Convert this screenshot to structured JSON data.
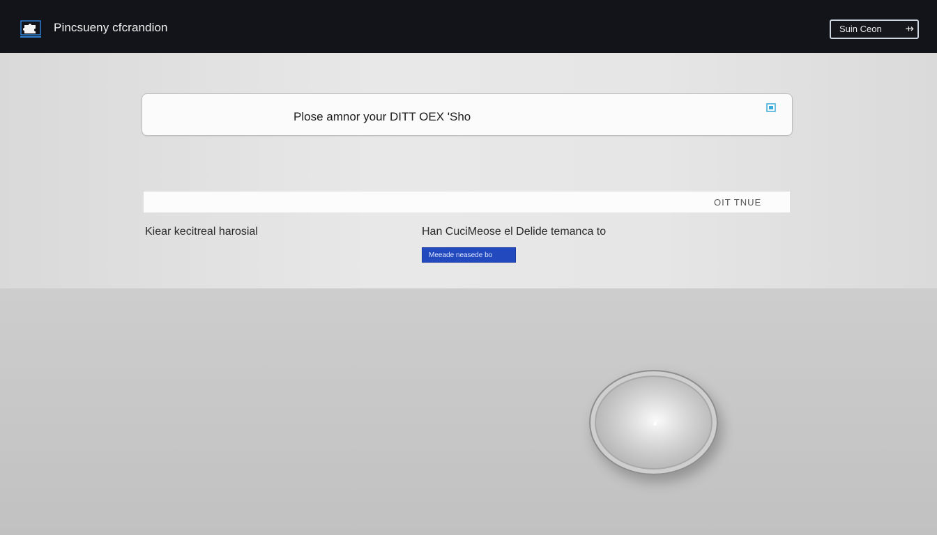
{
  "header": {
    "title": "Pincsueny cfcrandion",
    "logo_icon": "puzzle-icon",
    "button_label": "Suin Ceon",
    "button_icon": "arrow-exit-icon"
  },
  "prompt": {
    "text": "Plose amnor your DITT OEX 'Sho",
    "icon": "copy-icon"
  },
  "code_input": {
    "value": "",
    "hint": "OIT TNUE"
  },
  "labels": {
    "left": "Kiear kecitreal harosial",
    "right": "Han CuciMeose el Delide temanca to"
  },
  "action_button": {
    "label": "Meeade neasede bo",
    "color": "#2349bf"
  },
  "knob": {
    "icon": "dial-knob"
  },
  "colors": {
    "header_bg": "#131419",
    "accent": "#2f7fd0"
  }
}
